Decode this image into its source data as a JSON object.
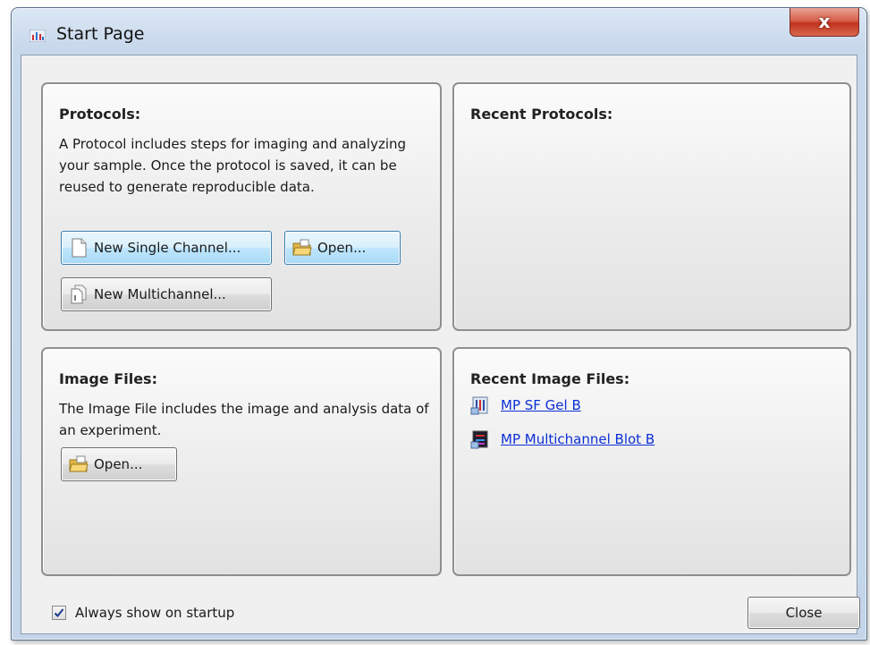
{
  "window": {
    "title": "Start Page",
    "close_glyph": "x"
  },
  "protocols": {
    "title": "Protocols:",
    "description": "A Protocol includes steps for imaging and analyzing your sample. Once the protocol is saved, it can be reused to generate reproducible data.",
    "new_single_label": "New Single Channel...",
    "open_label": "Open...",
    "new_multi_label": "New Multichannel..."
  },
  "recent_protocols": {
    "title": "Recent Protocols:"
  },
  "image_files": {
    "title": "Image Files:",
    "description": "The Image File includes the image and analysis data of an experiment.",
    "open_label": "Open..."
  },
  "recent_image_files": {
    "title": "Recent Image Files:",
    "items": [
      {
        "label": "MP SF Gel B",
        "icon": "gel-image-icon"
      },
      {
        "label": "MP Multichannel Blot B",
        "icon": "multichannel-blot-icon"
      }
    ]
  },
  "footer": {
    "always_show_label": "Always show on startup",
    "always_show_checked": true,
    "close_label": "Close"
  }
}
